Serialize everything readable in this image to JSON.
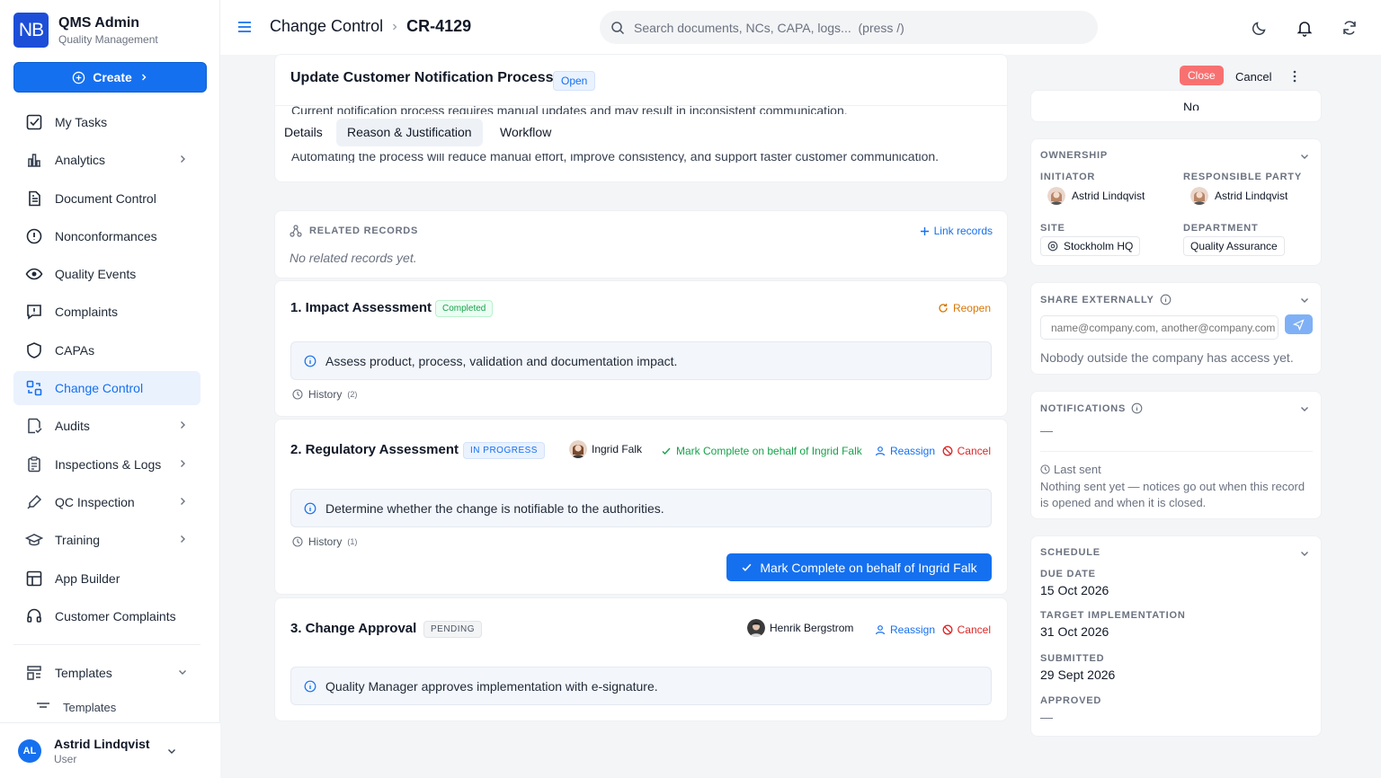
{
  "brand": {
    "logo": "NB",
    "name": "QMS Admin",
    "subtitle": "Quality Management"
  },
  "create_label": "Create",
  "nav": [
    {
      "label": "My Tasks",
      "icon": "checkbox-icon",
      "chevron": false
    },
    {
      "label": "Analytics",
      "icon": "bar-chart-icon",
      "chevron": true
    },
    {
      "label": "Document Control",
      "icon": "document-icon",
      "chevron": false
    },
    {
      "label": "Nonconformances",
      "icon": "alert-circle-icon",
      "chevron": false
    },
    {
      "label": "Quality Events",
      "icon": "eye-icon",
      "chevron": false
    },
    {
      "label": "Complaints",
      "icon": "message-alert-icon",
      "chevron": false
    },
    {
      "label": "CAPAs",
      "icon": "shield-icon",
      "chevron": false
    },
    {
      "label": "Change Control",
      "icon": "change-control-icon",
      "chevron": false,
      "active": true
    },
    {
      "label": "Audits",
      "icon": "audit-icon",
      "chevron": true
    },
    {
      "label": "Inspections & Logs",
      "icon": "clipboard-icon",
      "chevron": true
    },
    {
      "label": "QC Inspection",
      "icon": "pipette-icon",
      "chevron": true
    },
    {
      "label": "Training",
      "icon": "graduation-cap-icon",
      "chevron": true
    },
    {
      "label": "App Builder",
      "icon": "grid-icon",
      "chevron": false
    },
    {
      "label": "Customer Complaints",
      "icon": "headset-icon",
      "chevron": false
    }
  ],
  "templates": {
    "label": "Templates",
    "sub_label": "Templates"
  },
  "user": {
    "initials": "AL",
    "name": "Astrid Lindqvist",
    "role": "User"
  },
  "topbar": {
    "crumb_parent": "Change Control",
    "crumb_current": "CR-4129",
    "search_placeholder": "Search documents, NCs, CAPA, logs...  (press /)"
  },
  "record": {
    "title": "Update Customer Notification Process",
    "status": "Open",
    "close_label": "Close",
    "cancel_label": "Cancel",
    "bleed_top": "Current notification process requires manual updates and may result in inconsistent communication.",
    "bleed_bottom": "Automating the process will reduce manual effort, improve consistency, and support faster customer communication.",
    "tabs": [
      "Details",
      "Reason & Justification",
      "Workflow"
    ]
  },
  "related": {
    "label": "RELATED RECORDS",
    "link_label": "Link records",
    "empty": "No related records yet."
  },
  "steps": [
    {
      "title": "1. Impact Assessment",
      "status": "Completed",
      "reopen_label": "Reopen",
      "info": "Assess product, process, validation and documentation impact.",
      "history_label": "History",
      "history_count": "(2)"
    },
    {
      "title": "2. Regulatory Assessment",
      "status": "IN PROGRESS",
      "assignee": "Ingrid Falk",
      "mark_complete_label": "Mark Complete on behalf of Ingrid Falk",
      "reassign_label": "Reassign",
      "cancel_label": "Cancel",
      "info": "Determine whether the change is notifiable to the authorities.",
      "history_label": "History",
      "history_count": "(1)",
      "button_label": "Mark Complete on behalf of Ingrid Falk"
    },
    {
      "title": "3. Change Approval",
      "status": "PENDING",
      "assignee": "Henrik Bergstrom",
      "reassign_label": "Reassign",
      "cancel_label": "Cancel",
      "info": "Quality Manager approves implementation with e-signature."
    }
  ],
  "right": {
    "top_value": "No",
    "ownership": {
      "title": "OWNERSHIP",
      "initiator_label": "INITIATOR",
      "initiator": "Astrid Lindqvist",
      "responsible_label": "RESPONSIBLE PARTY",
      "responsible": "Astrid Lindqvist",
      "site_label": "SITE",
      "site": "Stockholm HQ",
      "department_label": "DEPARTMENT",
      "department": "Quality Assurance"
    },
    "share": {
      "title": "SHARE EXTERNALLY",
      "placeholder": "name@company.com, another@company.com",
      "note": "Nobody outside the company has access yet."
    },
    "notifications": {
      "title": "NOTIFICATIONS",
      "value": "—",
      "last_sent_label": "Last sent",
      "last_sent_text": "Nothing sent yet — notices go out when this record is opened and when it is closed."
    },
    "schedule": {
      "title": "SCHEDULE",
      "due_label": "DUE DATE",
      "due": "15 Oct 2026",
      "target_label": "TARGET IMPLEMENTATION",
      "target": "31 Oct 2026",
      "submitted_label": "SUBMITTED",
      "submitted": "29 Sept 2026",
      "approved_label": "APPROVED",
      "approved": "—"
    }
  },
  "colors": {
    "accent": "#1570ef",
    "success": "#16a34a",
    "danger": "#dc2626",
    "warning": "#d97706",
    "close_button": "#f87171"
  }
}
